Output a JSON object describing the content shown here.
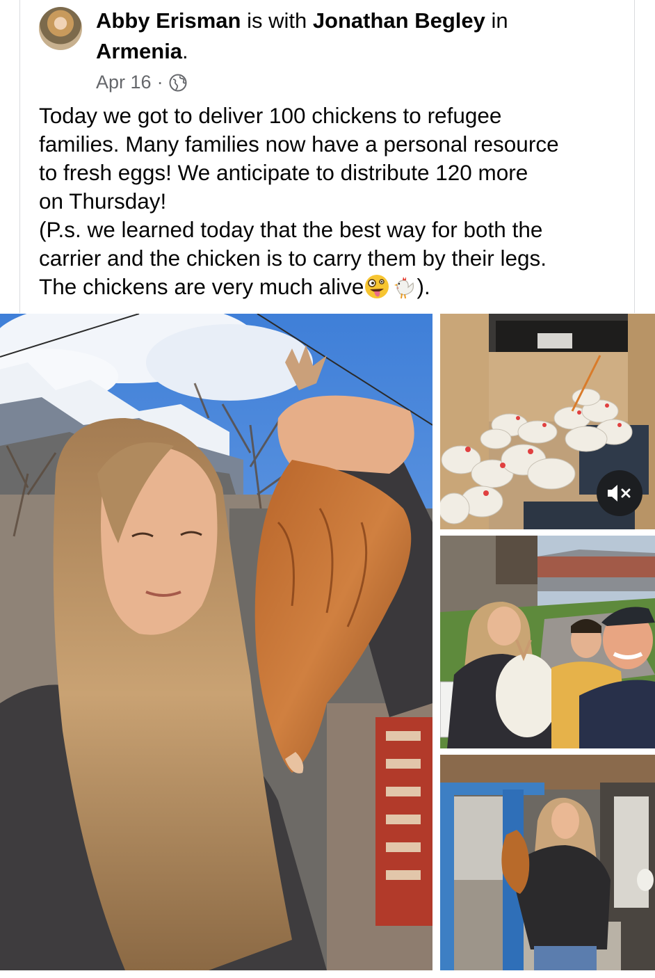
{
  "post": {
    "author": "Abby Erisman",
    "with_text": " is with ",
    "tagged": "Jonathan Begley",
    "in_text": " in",
    "location": "Armenia",
    "location_suffix": ".",
    "date": "Apr 16",
    "separator": "·",
    "privacy_icon": "globe-icon",
    "body": "Today we got to deliver 100 chickens to refugee\nfamilies. Many families now have a personal resource\nto fresh eggs! We anticipate to distribute 120 more\non Thursday!\n(P.s. we learned today that the best way for both the\ncarrier and the chicken is to carry them by their legs.\nThe chickens are very much alive",
    "body_end": ").",
    "emojis": [
      "zany-face-emoji",
      "rooster-emoji"
    ]
  },
  "media": {
    "photos": [
      {
        "name": "photo-main",
        "subject": "girl-holding-chicken"
      },
      {
        "name": "photo-van",
        "subject": "chickens-in-van"
      },
      {
        "name": "photo-group",
        "subject": "group-with-chickens"
      },
      {
        "name": "photo-doorway",
        "subject": "girl-in-doorway"
      }
    ],
    "mute_icon": "speaker-muted-icon"
  },
  "colors": {
    "name_text": "#050505",
    "meta_text": "#65676b",
    "mute_button_bg": "#1c1e21"
  }
}
